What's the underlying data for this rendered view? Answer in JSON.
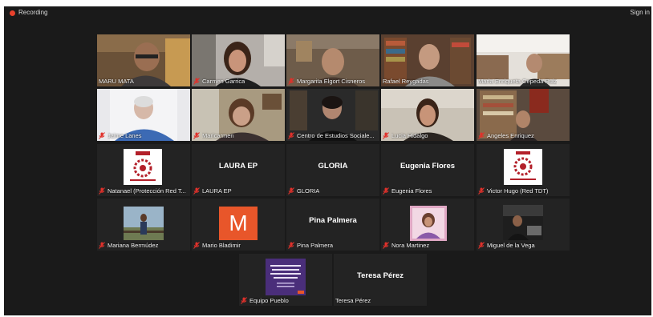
{
  "topbar": {
    "recording_label": "Recording",
    "signin_label": "Sign in"
  },
  "participants": [
    {
      "name": "MARU MATA",
      "mic_muted": false,
      "display": "video"
    },
    {
      "name": "Carmen Garrica",
      "mic_muted": true,
      "display": "video"
    },
    {
      "name": "Margarita Elgort Cisneros",
      "mic_muted": true,
      "display": "video"
    },
    {
      "name": "Rafael Reygadas",
      "mic_muted": false,
      "display": "video",
      "active_speaker": true
    },
    {
      "name": "Maria Enriqueta Cepeda Ruiz",
      "mic_muted": false,
      "display": "video"
    },
    {
      "name": "Jaime Lanes",
      "mic_muted": true,
      "display": "video"
    },
    {
      "name": "Maricarmen",
      "mic_muted": true,
      "display": "video"
    },
    {
      "name": "Centro de Estudios Sociale...",
      "mic_muted": true,
      "display": "video"
    },
    {
      "name": "Lucia Hidalgo",
      "mic_muted": true,
      "display": "video"
    },
    {
      "name": "Angeles Enriquez",
      "mic_muted": true,
      "display": "video"
    },
    {
      "name": "Natanael (Protección Red T...",
      "mic_muted": true,
      "display": "logo",
      "logo_text": "RED TDT"
    },
    {
      "name": "LAURA EP",
      "mic_muted": true,
      "display": "name",
      "center_name": "LAURA EP"
    },
    {
      "name": "GLORIA",
      "mic_muted": true,
      "display": "name",
      "center_name": "GLORIA"
    },
    {
      "name": "Eugenia Flores",
      "mic_muted": true,
      "display": "name",
      "center_name": "Eugenia Flores"
    },
    {
      "name": "Victor Hugo (Red TDT)",
      "mic_muted": true,
      "display": "logo",
      "logo_text": "RED TDT"
    },
    {
      "name": "Mariana Bermúdez",
      "mic_muted": true,
      "display": "photo"
    },
    {
      "name": "Mario Bladimir",
      "mic_muted": true,
      "display": "avatar",
      "avatar_letter": "M",
      "avatar_color": "#e8562a"
    },
    {
      "name": "Pina Palmera",
      "mic_muted": true,
      "display": "name",
      "center_name": "Pina Palmera"
    },
    {
      "name": "Nora Martinez",
      "mic_muted": true,
      "display": "photo"
    },
    {
      "name": "Miguel de la Vega",
      "mic_muted": true,
      "display": "photo"
    },
    {
      "name": "Equipo Pueblo",
      "mic_muted": true,
      "display": "poster"
    },
    {
      "name": "Teresa Pérez",
      "mic_muted": false,
      "display": "name",
      "center_name": "Teresa Pérez"
    }
  ]
}
